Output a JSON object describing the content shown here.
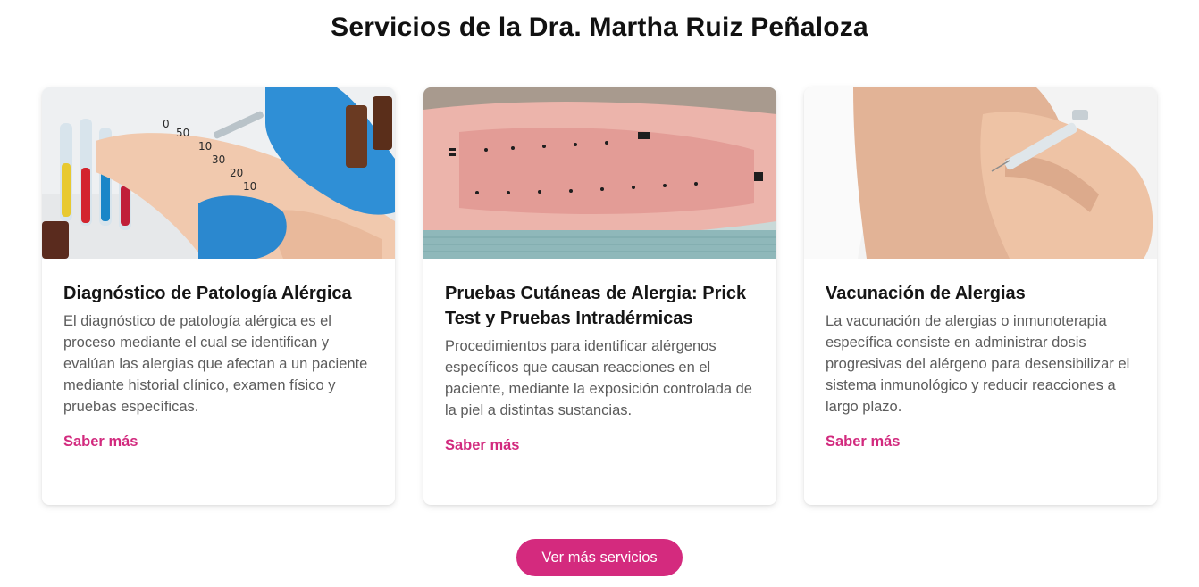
{
  "page": {
    "title": "Servicios de la Dra. Martha Ruiz Peñaloza"
  },
  "services": [
    {
      "title": "Diagnóstico de Patología Alérgica",
      "description": "El diagnóstico de patología alérgica es el proceso mediante el cual se identifican y evalúan las alergias que afectan a un paciente mediante historial clínico, examen físico y pruebas específicas.",
      "link_label": "Saber más"
    },
    {
      "title": "Pruebas Cutáneas de Alergia: Prick Test y Pruebas Intradérmicas",
      "description": "Procedimientos para identificar alérgenos específicos que causan reacciones en el paciente, mediante la exposición controlada de la piel a distintas sustancias.",
      "link_label": "Saber más"
    },
    {
      "title": "Vacunación de Alergias",
      "description": "La vacunación de alergias o inmunoterapia específica consiste en administrar dosis progresivas del alérgeno para desensibilizar el sistema inmunológico y reducir reacciones a largo plazo.",
      "link_label": "Saber más"
    }
  ],
  "cta": {
    "label": "Ver más servicios"
  },
  "colors": {
    "accent": "#d42a7e",
    "link": "#d22a7e",
    "body_text": "#5c5c5c"
  }
}
